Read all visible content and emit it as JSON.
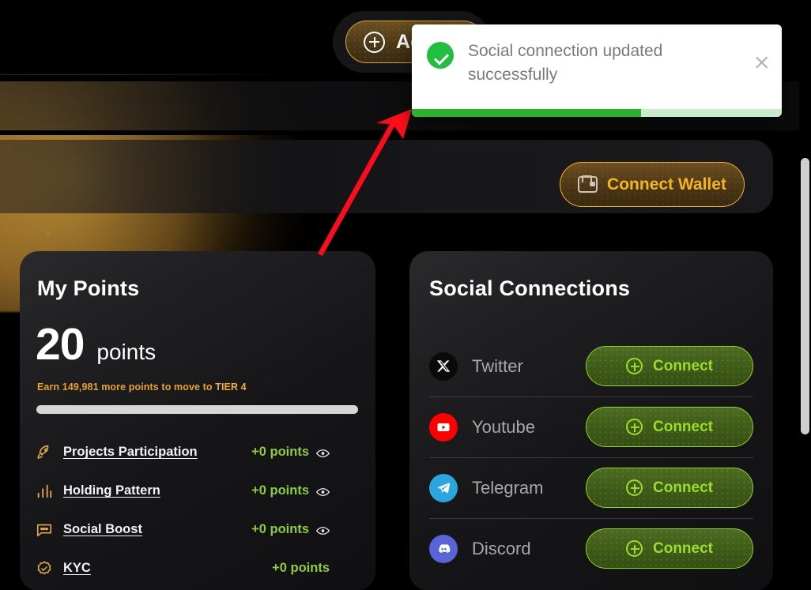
{
  "toast": {
    "message": "Social connection updated successfully",
    "close_label": "×",
    "progress_percent": 62,
    "icon": "success-check-icon",
    "accent_color": "#2ab32a"
  },
  "top_button": {
    "label": "Ad",
    "icon": "plus-circle-icon",
    "border_color": "#e0a23a"
  },
  "wallet": {
    "label": "Connect Wallet",
    "icon": "wallet-icon",
    "accent_color": "#f5b521"
  },
  "points_card": {
    "title": "My Points",
    "value": "20",
    "unit": "points",
    "tier_prefix": "Earn 149,981 more points to move to ",
    "tier_target": "TIER 4",
    "progress_percent": 0,
    "items": [
      {
        "icon": "rocket-icon",
        "label": "Projects Participation",
        "points": "+0 points",
        "has_eye": true
      },
      {
        "icon": "bar-chart-icon",
        "label": "Holding Pattern",
        "points": "+0 points",
        "has_eye": true
      },
      {
        "icon": "chat-bubble-icon",
        "label": "Social Boost",
        "points": "+0 points",
        "has_eye": true
      },
      {
        "icon": "badge-check-icon",
        "label": "KYC",
        "points": "+0 points",
        "has_eye": false
      }
    ],
    "points_color": "#8dcc3f",
    "tier_color": "#e9a227"
  },
  "social_card": {
    "title": "Social Connections",
    "rows": [
      {
        "icon": "twitter-x-icon",
        "name": "Twitter",
        "button_label": "Connect",
        "brand_color": "#0a0a0a"
      },
      {
        "icon": "youtube-icon",
        "name": "Youtube",
        "button_label": "Connect",
        "brand_color": "#ff0000"
      },
      {
        "icon": "telegram-icon",
        "name": "Telegram",
        "button_label": "Connect",
        "brand_color": "#2aa5e0"
      },
      {
        "icon": "discord-icon",
        "name": "Discord",
        "button_label": "Connect",
        "brand_color": "#5865d8"
      }
    ],
    "button_color": "#9bdd2b"
  },
  "annotation": {
    "type": "red-arrow",
    "color": "#fc0d1b"
  }
}
